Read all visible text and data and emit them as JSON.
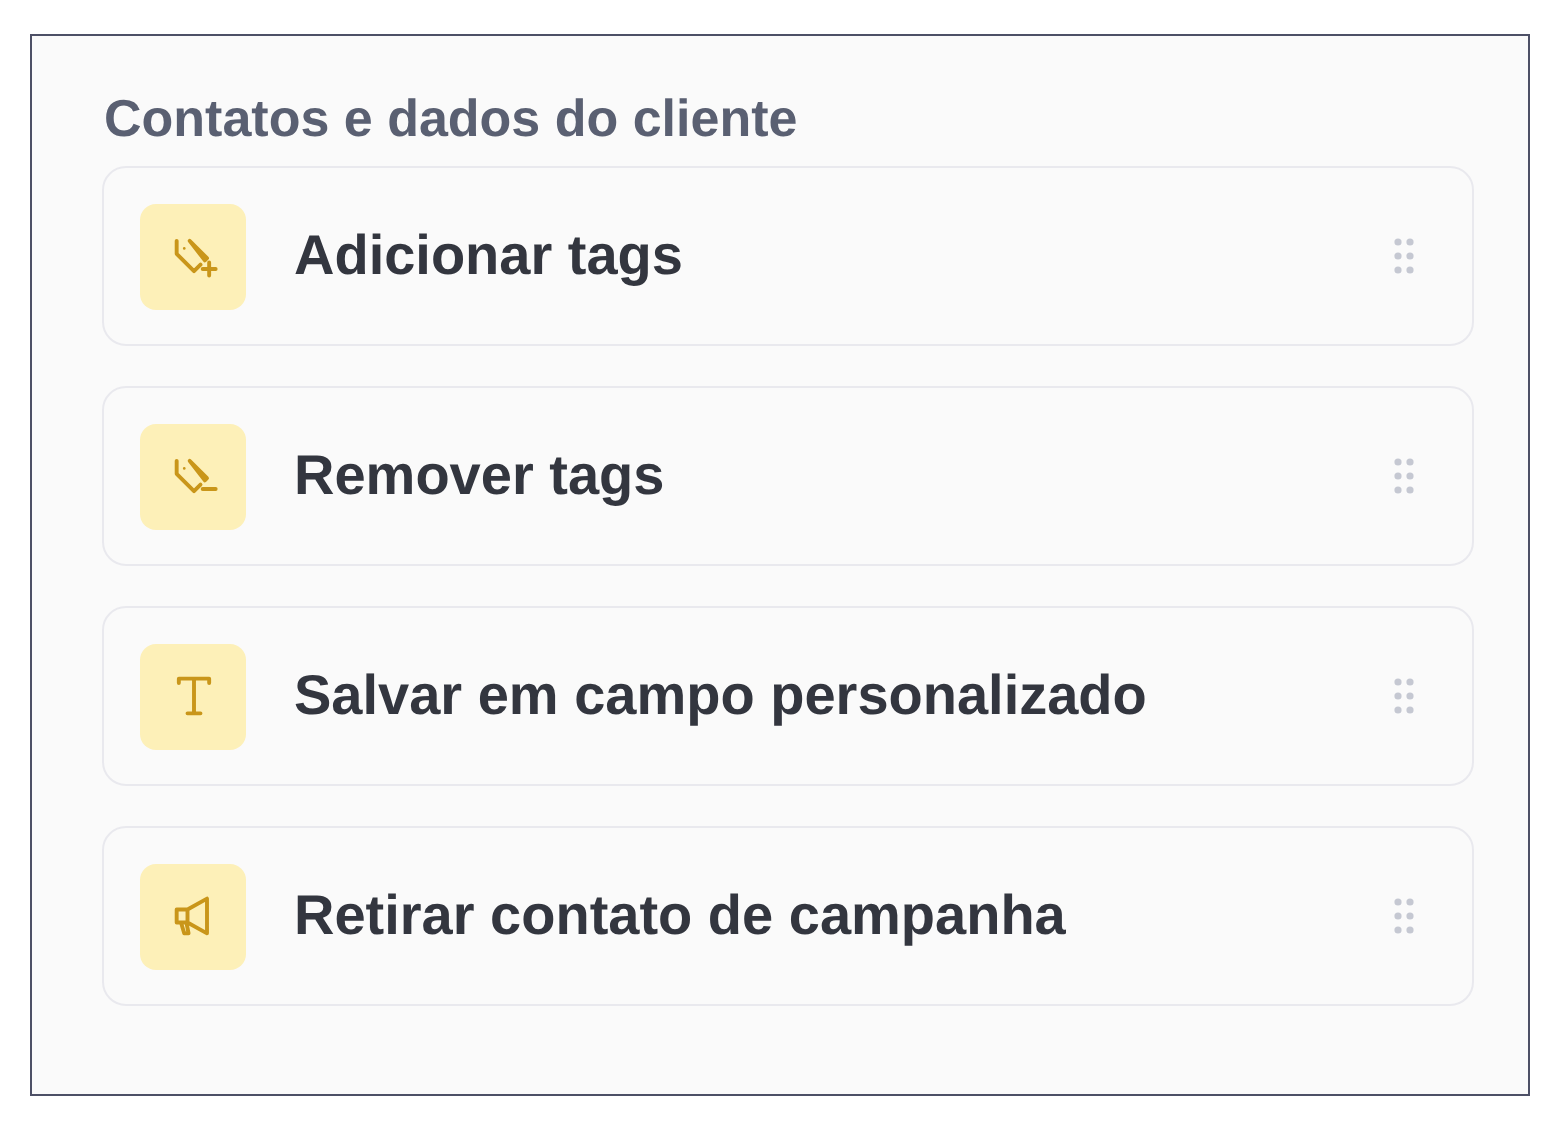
{
  "section": {
    "title": "Contatos e dados do cliente"
  },
  "actions": [
    {
      "kind": "tag-add",
      "label": "Adicionar tags"
    },
    {
      "kind": "tag-remove",
      "label": "Remover tags"
    },
    {
      "kind": "text",
      "label": "Salvar em campo personalizado"
    },
    {
      "kind": "megaphone",
      "label": "Retirar contato de campanha"
    }
  ]
}
